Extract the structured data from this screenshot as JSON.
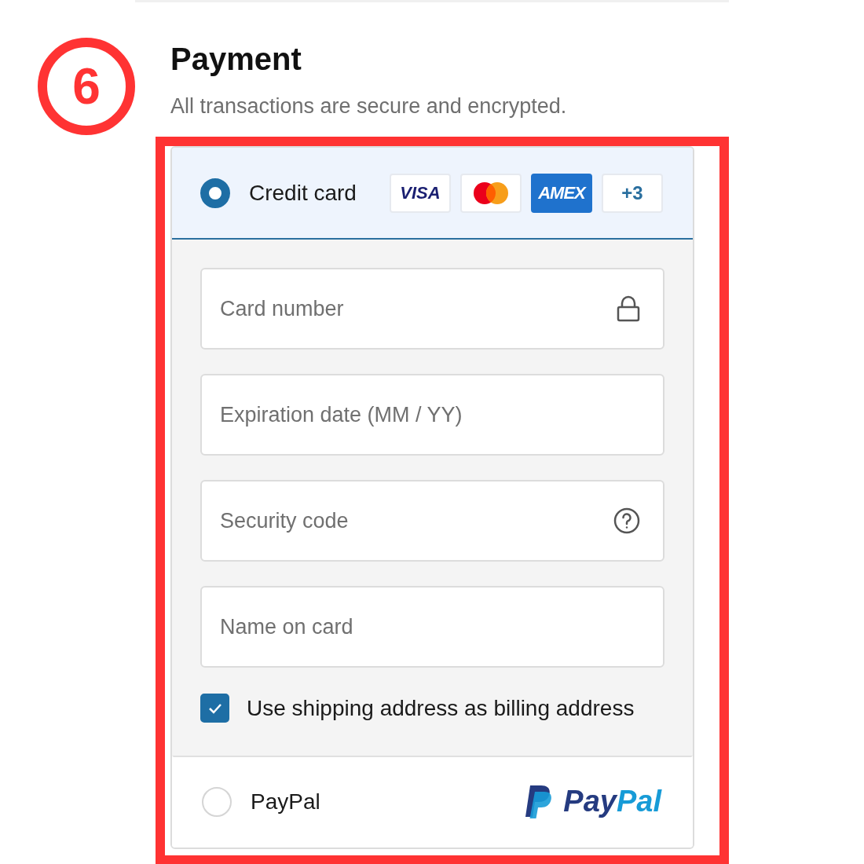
{
  "step": {
    "number": "6"
  },
  "header": {
    "title": "Payment",
    "subtitle": "All transactions are secure and encrypted."
  },
  "methods": [
    {
      "kind": "card",
      "label": "Credit card",
      "selected": true,
      "brands": [
        {
          "kind": "visa",
          "label": "VISA"
        },
        {
          "kind": "mastercard"
        },
        {
          "kind": "amex",
          "label": "AMEX"
        },
        {
          "kind": "more",
          "label": "+3"
        }
      ],
      "fields": [
        {
          "kind": "secure",
          "placeholder": "Card number"
        },
        {
          "kind": "plain",
          "placeholder": "Expiration date (MM / YY)"
        },
        {
          "kind": "hint",
          "placeholder": "Security code"
        },
        {
          "kind": "plain",
          "placeholder": "Name on card"
        }
      ],
      "billing": {
        "label": "Use shipping address as billing address",
        "checked": true
      }
    },
    {
      "kind": "paypal",
      "label": "PayPal",
      "selected": false,
      "logo": [
        "Pay",
        "Pal"
      ]
    }
  ]
}
